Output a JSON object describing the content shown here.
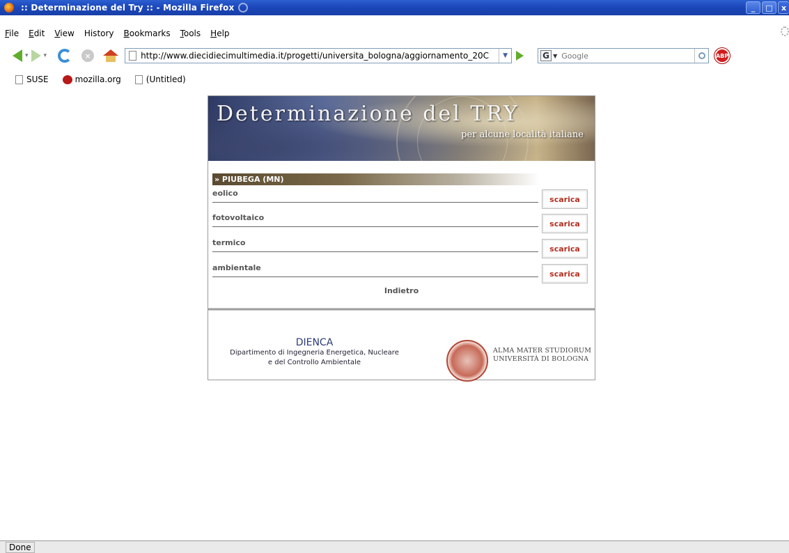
{
  "window": {
    "title": ":: Determinazione del Try :: - Mozilla Firefox",
    "buttons": {
      "minimize": "_",
      "maximize": "□",
      "close": "x"
    }
  },
  "menu": [
    {
      "label": "File",
      "key": "F",
      "rest": "ile"
    },
    {
      "label": "Edit",
      "key": "E",
      "rest": "dit"
    },
    {
      "label": "View",
      "key": "V",
      "rest": "iew"
    },
    {
      "label": "History",
      "key": "",
      "rest": "History"
    },
    {
      "label": "Bookmarks",
      "key": "B",
      "rest": "ookmarks"
    },
    {
      "label": "Tools",
      "key": "T",
      "rest": "ools"
    },
    {
      "label": "Help",
      "key": "H",
      "rest": "elp"
    }
  ],
  "navbar": {
    "url": "http://www.diecidiecimultimedia.it/progetti/universita_bologna/aggiornamento_20C",
    "search_placeholder": "Google",
    "search_engine_letter": "G",
    "abp_label": "ABP"
  },
  "bookmarks": [
    "SUSE",
    "mozilla.org",
    "(Untitled)"
  ],
  "page": {
    "banner_title": "Determinazione del TRY",
    "banner_subtitle": "per alcune località italiane",
    "location": "» PIUBEGA (MN)",
    "rows": [
      {
        "label": "eolico",
        "button": "scarica"
      },
      {
        "label": "fotovoltaico",
        "button": "scarica"
      },
      {
        "label": "termico",
        "button": "scarica"
      },
      {
        "label": "ambientale",
        "button": "scarica"
      }
    ],
    "back_label": "Indietro",
    "dienca": {
      "title": "DIENCA",
      "line1": "Dipartimento di Ingegneria Energetica, Nucleare",
      "line2": "e del Controllo Ambientale"
    },
    "unibo": {
      "line1": "ALMA MATER STUDIORUM",
      "line2": "UNIVERSITÀ DI BOLOGNA"
    }
  },
  "status": "Done",
  "colors": {
    "titlebar": "#1b46b8",
    "scarica": "#b03020",
    "dienca": "#2a3a7a"
  }
}
